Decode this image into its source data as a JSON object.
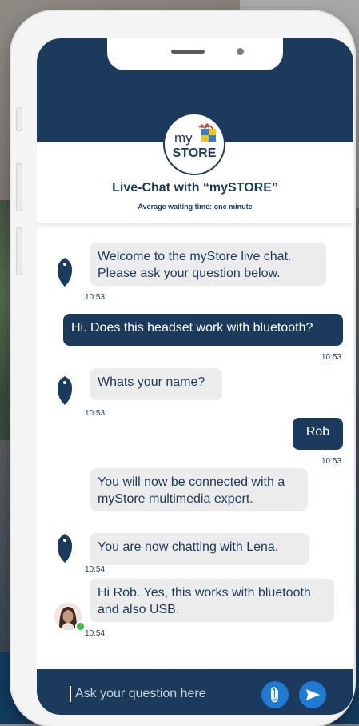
{
  "colors": {
    "brand_navy": "#1c3a5c",
    "bubble_gray": "#ececec",
    "action_blue": "#1f7ad1",
    "online_green": "#3fbf4a"
  },
  "logo": {
    "top": "my",
    "bottom": "STORE"
  },
  "header": {
    "title": "Live-Chat with “mySTORE”",
    "subtitle": "Average waiting time: one minute"
  },
  "messages": [
    {
      "sender": "bot",
      "lines": [
        "Welcome to the myStore live chat.",
        "Please ask your question below."
      ],
      "time": "10:53"
    },
    {
      "sender": "user",
      "lines": [
        "Hi. Does this headset work with bluetooth?"
      ],
      "time": "10:53"
    },
    {
      "sender": "bot",
      "lines": [
        "Whats your name?"
      ],
      "time": "10:53"
    },
    {
      "sender": "user",
      "lines": [
        "Rob"
      ],
      "time": "10:53"
    },
    {
      "sender": "bot",
      "lines": [
        "You will now be connected with a",
        "myStore multimedia expert."
      ],
      "time": ""
    },
    {
      "sender": "bot",
      "lines": [
        "You are now chatting with Lena."
      ],
      "time": "10:54"
    },
    {
      "sender": "agent",
      "lines": [
        "Hi Rob. Yes, this works with bluetooth",
        "and also USB."
      ],
      "time": "10:54"
    }
  ],
  "composer": {
    "placeholder": "Ask your question here",
    "attach_icon": "paperclip-icon",
    "send_icon": "send-icon"
  }
}
